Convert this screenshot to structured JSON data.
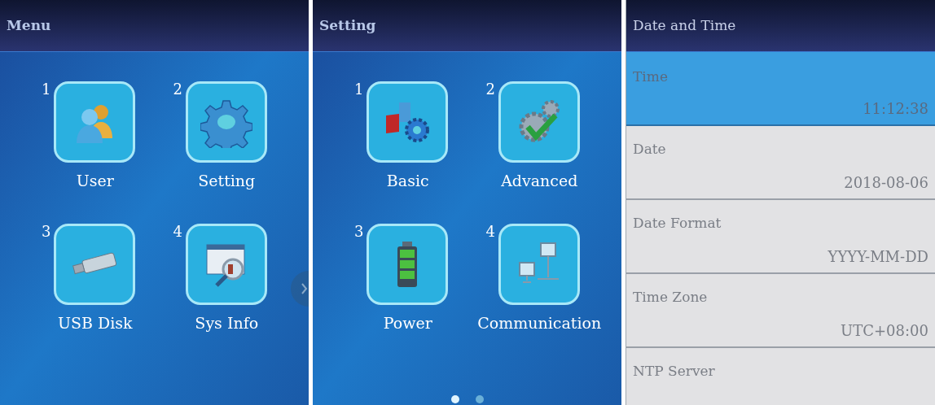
{
  "panels": [
    {
      "kind": "grid",
      "title": "Menu",
      "next_arrow": true,
      "items": [
        {
          "number": "1",
          "label": "User",
          "kind": "user"
        },
        {
          "number": "2",
          "label": "Setting",
          "kind": "gear"
        },
        {
          "number": "3",
          "label": "USB Disk",
          "kind": "usb"
        },
        {
          "number": "4",
          "label": "Sys Info",
          "kind": "info"
        }
      ]
    },
    {
      "kind": "grid",
      "title": "Setting",
      "items": [
        {
          "number": "1",
          "label": "Basic",
          "kind": "basic"
        },
        {
          "number": "2",
          "label": "Advanced",
          "kind": "advanced"
        },
        {
          "number": "3",
          "label": "Power",
          "kind": "battery"
        },
        {
          "number": "4",
          "label": "Communication",
          "kind": "network"
        }
      ],
      "pages": [
        {
          "selected": true
        },
        {
          "selected": false
        }
      ]
    },
    {
      "kind": "list",
      "title": "Date and Time",
      "rows": [
        {
          "label": "Time",
          "value": "11:12:38",
          "selected": true
        },
        {
          "label": "Date",
          "value": "2018-08-06",
          "selected": false
        },
        {
          "label": "Date Format",
          "value": "YYYY-MM-DD",
          "selected": false
        },
        {
          "label": "Time Zone",
          "value": "UTC+08:00",
          "selected": false
        },
        {
          "label": "NTP Server",
          "selected": false
        }
      ]
    }
  ]
}
